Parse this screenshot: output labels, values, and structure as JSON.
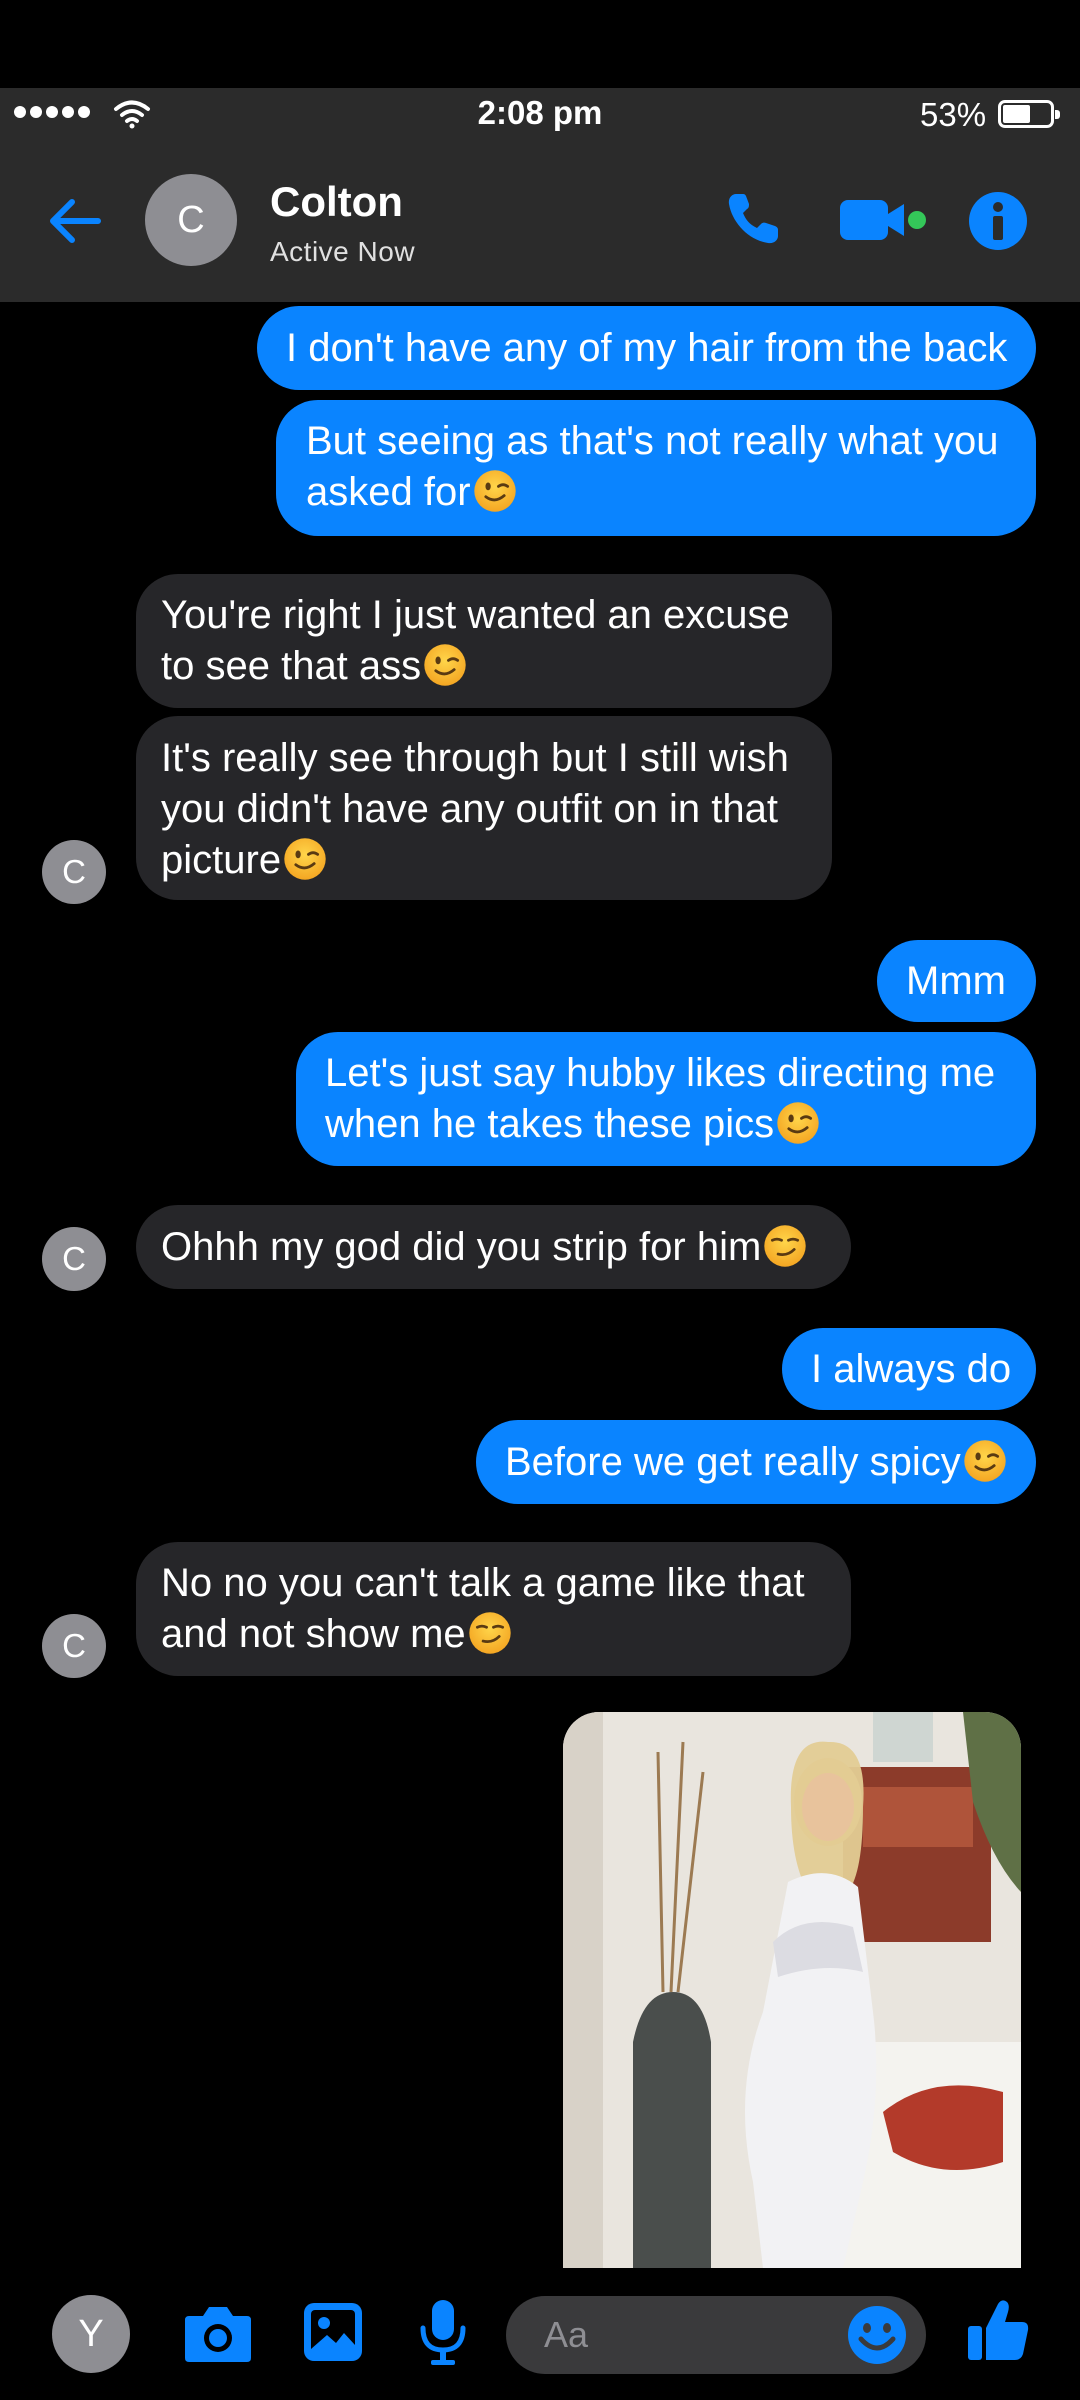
{
  "status_bar": {
    "time": "2:08 pm",
    "battery_percent": "53%",
    "battery_level": 0.53
  },
  "header": {
    "avatar_initial": "C",
    "name": "Colton",
    "status": "Active Now"
  },
  "colors": {
    "accent": "#0a84ff",
    "incoming_bubble": "#262629",
    "header_bg": "#2b2b2b",
    "video_dot": "#34c759"
  },
  "messages": [
    {
      "sender": "me",
      "text": "I don't have any of my hair from the back"
    },
    {
      "sender": "me",
      "lines": [
        "But seeing as that's not really what you",
        "asked for"
      ],
      "emoji": "wink"
    },
    {
      "sender": "Colton",
      "lines": [
        "You're right I just wanted an excuse",
        "to see that ass"
      ],
      "emoji": "wink"
    },
    {
      "sender": "Colton",
      "lines": [
        "It's really see through but I still wish",
        "you didn't have any outfit on in that",
        "picture"
      ],
      "emoji": "wink"
    },
    {
      "sender": "me",
      "text": "Mmm"
    },
    {
      "sender": "me",
      "lines": [
        "Let's just say hubby likes directing me",
        "when he takes these pics"
      ],
      "emoji": "wink"
    },
    {
      "sender": "Colton",
      "text": "Ohhh my god did you strip for him",
      "emoji": "smirk"
    },
    {
      "sender": "me",
      "text": "I always do"
    },
    {
      "sender": "me",
      "text": "Before we get really spicy",
      "emoji": "wink"
    },
    {
      "sender": "Colton",
      "lines": [
        "No no you can't talk a game like that",
        "and not show me"
      ],
      "emoji": "smirk"
    },
    {
      "sender": "me",
      "type": "photo"
    }
  ],
  "avatars": {
    "contact_initial": "C",
    "me_initial": "Y"
  },
  "composer": {
    "placeholder": "Aa"
  },
  "icons": [
    "back-arrow-icon",
    "phone-icon",
    "video-camera-icon",
    "info-icon",
    "camera-icon",
    "gallery-icon",
    "microphone-icon",
    "emoji-icon",
    "thumbs-up-icon"
  ]
}
